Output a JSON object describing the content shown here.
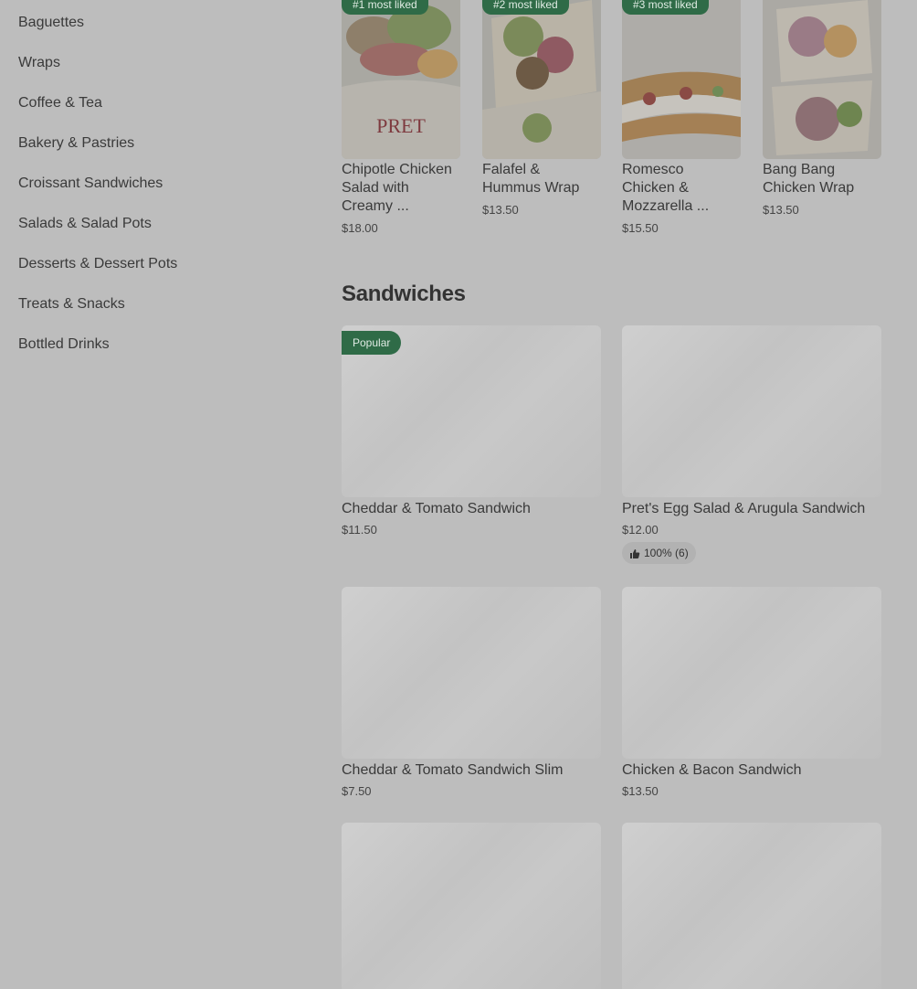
{
  "sidebar": {
    "items": [
      {
        "label": "Baguettes"
      },
      {
        "label": "Wraps"
      },
      {
        "label": "Coffee & Tea"
      },
      {
        "label": "Bakery & Pastries"
      },
      {
        "label": "Croissant Sandwiches"
      },
      {
        "label": "Salads & Salad Pots"
      },
      {
        "label": "Desserts & Dessert Pots"
      },
      {
        "label": "Treats & Snacks"
      },
      {
        "label": "Bottled Drinks"
      }
    ]
  },
  "most_liked": [
    {
      "badge": "#1 most liked",
      "name": "Chipotle Chicken Salad with Creamy ...",
      "price": "$18.00",
      "image_text": "PRET"
    },
    {
      "badge": "#2 most liked",
      "name": "Falafel & Hummus Wrap",
      "price": "$13.50"
    },
    {
      "badge": "#3 most liked",
      "name": "Romesco Chicken & Mozzarella ...",
      "price": "$15.50"
    },
    {
      "badge": "",
      "name": "Bang Bang Chicken Wrap",
      "price": "$13.50"
    }
  ],
  "section": {
    "title": "Sandwiches"
  },
  "products": [
    {
      "name": "Cheddar & Tomato Sandwich",
      "price": "$11.50",
      "badge": "Popular"
    },
    {
      "name": "Pret's Egg Salad & Arugula Sandwich",
      "price": "$12.00",
      "rating": "100% (6)"
    },
    {
      "name": "Cheddar & Tomato Sandwich Slim",
      "price": "$7.50"
    },
    {
      "name": "Chicken & Bacon Sandwich",
      "price": "$13.50"
    },
    {
      "name": "",
      "price": ""
    },
    {
      "name": "",
      "price": ""
    }
  ],
  "colors": {
    "overlay": "#bdbdbd",
    "badge_green": "#2f6b47",
    "text": "#3a3a3a"
  }
}
